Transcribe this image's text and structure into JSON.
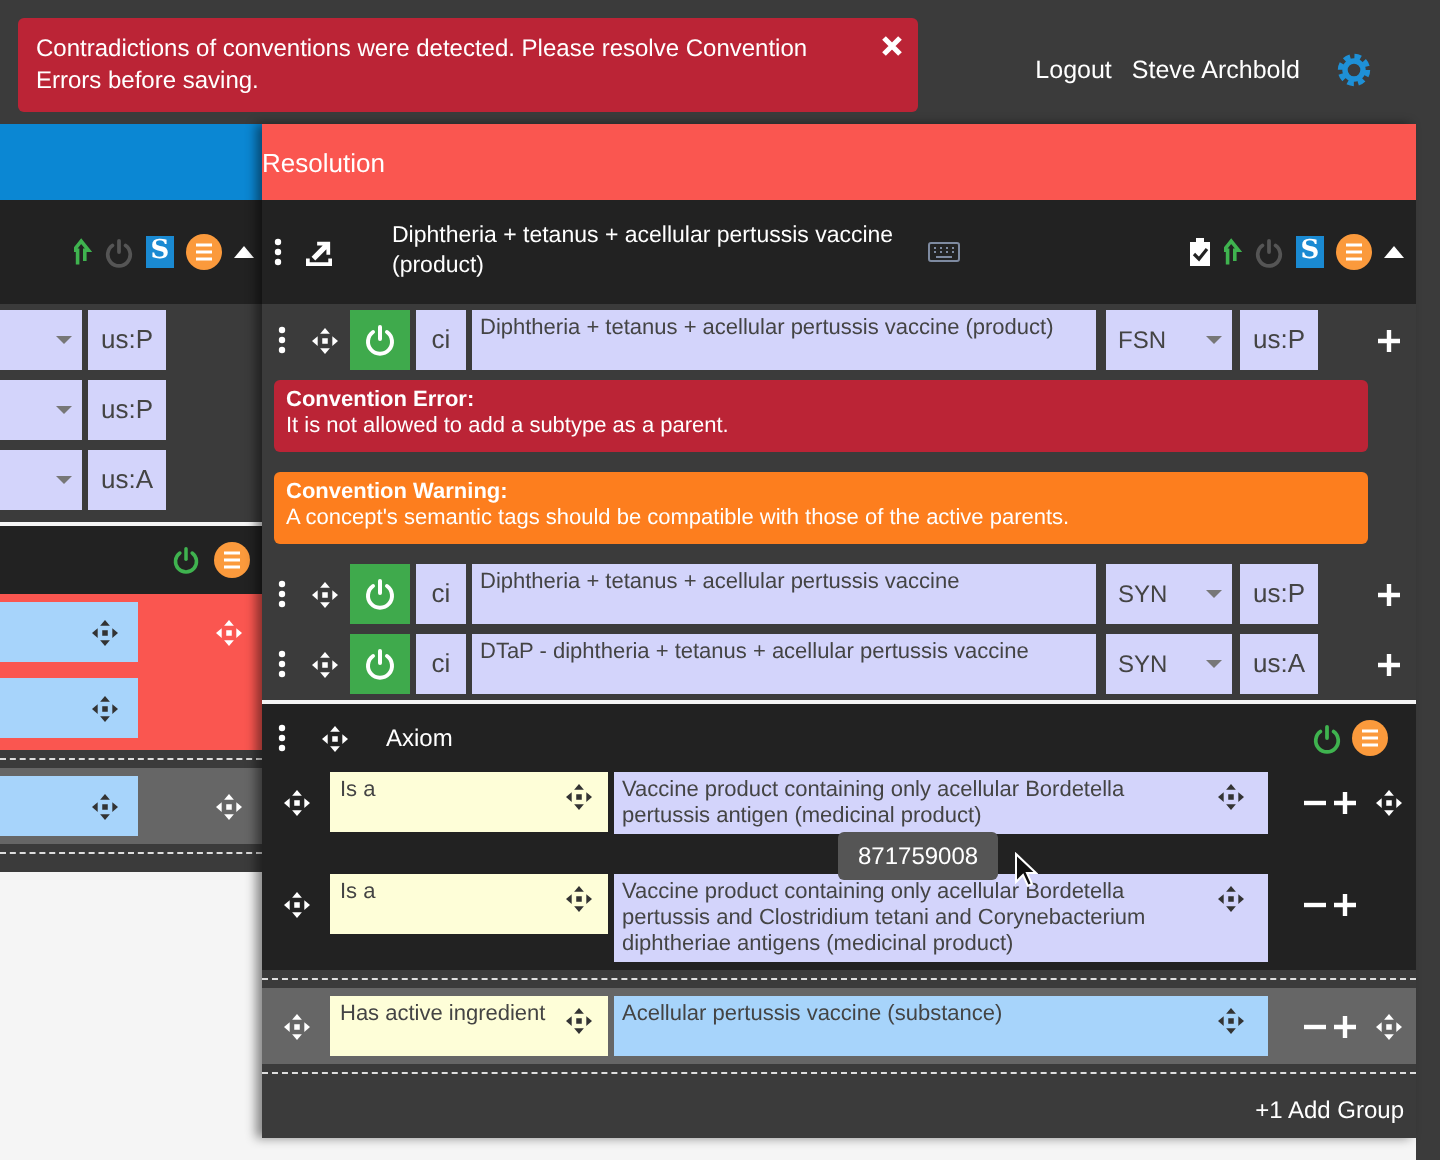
{
  "alert": {
    "message": "Contradictions of conventions were detected. Please resolve Convention Errors before saving."
  },
  "user_menu": {
    "logout": "Logout",
    "user": "Steve Archbold"
  },
  "left_panel": {
    "concept": {
      "active": false,
      "badge": "S"
    },
    "descriptions": [
      {
        "acceptability": "us:P"
      },
      {
        "acceptability": "us:P"
      },
      {
        "acceptability": "us:A"
      }
    ],
    "axiom": {
      "active": true,
      "groups": [
        {
          "kind": "conflict",
          "relationships": [
            {
              "kind": "attribute"
            },
            {
              "kind": "attribute"
            }
          ]
        },
        {
          "kind": "group",
          "relationships": [
            {
              "kind": "attribute"
            }
          ]
        }
      ]
    }
  },
  "resolution": {
    "title": "Resolution",
    "concept": {
      "title": "Diphtheria + tetanus + acellular pertussis vaccine (product)",
      "active": false,
      "badge": "S"
    },
    "descriptions": [
      {
        "active": true,
        "case": "ci",
        "term": "Diphtheria + tetanus + acellular pertussis vaccine (product)",
        "type": "FSN",
        "acceptability": "us:P",
        "messages": [
          {
            "kind": "error",
            "title": "Convention Error:",
            "text": "It is not allowed to add a subtype as a parent."
          },
          {
            "kind": "warning",
            "title": "Convention Warning:",
            "text": "A concept's semantic tags should be compatible with those of the active parents."
          }
        ]
      },
      {
        "active": true,
        "case": "ci",
        "term": "Diphtheria + tetanus + acellular pertussis vaccine",
        "type": "SYN",
        "acceptability": "us:P"
      },
      {
        "active": true,
        "case": "ci",
        "term": "DTaP - diphtheria + tetanus + acellular pertussis vaccine",
        "type": "SYN",
        "acceptability": "us:A"
      }
    ],
    "axiom": {
      "title": "Axiom",
      "active": true,
      "groups": [
        {
          "kind": "ungrouped",
          "relationships": [
            {
              "kind": "parent",
              "type": "Is a",
              "target": "Vaccine product containing only acellular Bordetella pertussis antigen (medicinal product)"
            },
            {
              "kind": "parent",
              "type": "Is a",
              "target": "Vaccine product containing only acellular Bordetella pertussis and Clostridium tetani and Corynebacterium diphtheriae antigens (medicinal product)"
            }
          ]
        },
        {
          "kind": "group",
          "relationships": [
            {
              "kind": "attribute",
              "type": "Has active ingredient",
              "target": "Acellular pertussis vaccine (substance)"
            }
          ]
        }
      ],
      "add_group": "+1 Add Group"
    },
    "tooltip": {
      "text": "871759008"
    }
  }
}
